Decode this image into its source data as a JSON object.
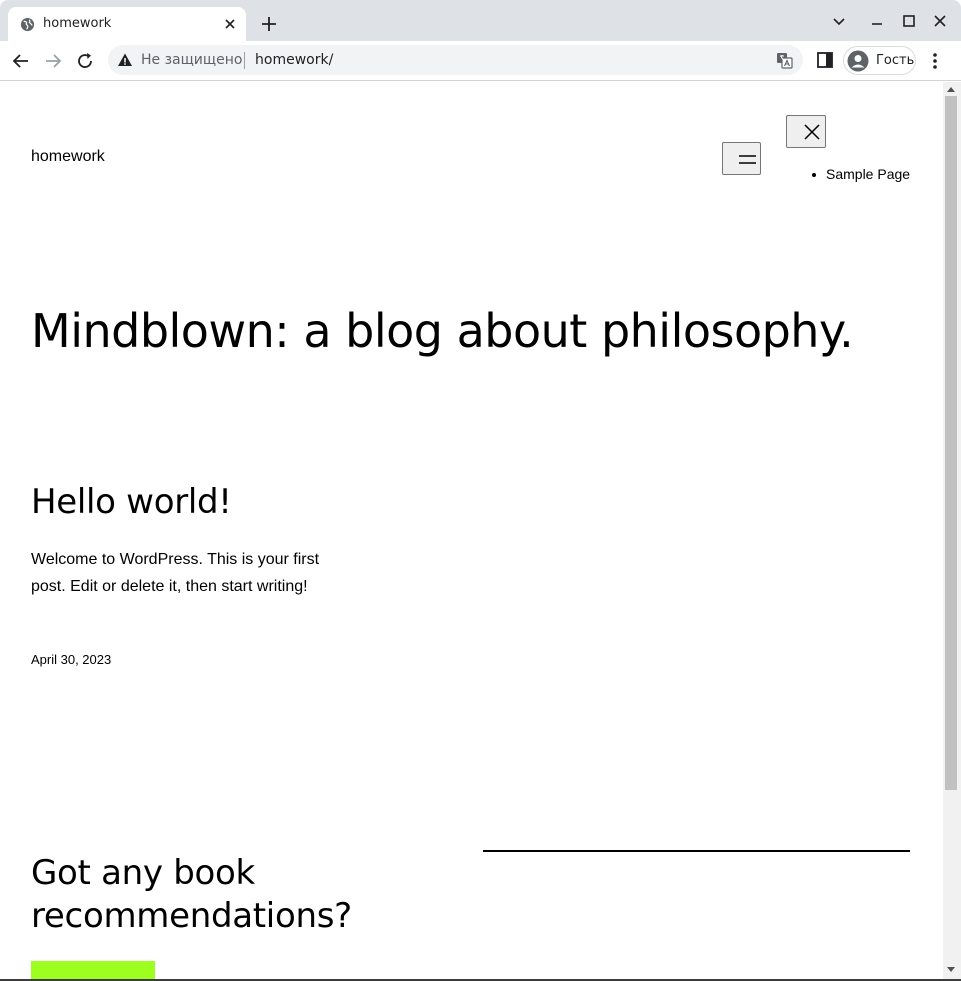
{
  "browser": {
    "tab": {
      "title": "homework"
    },
    "address_bar": {
      "security_label": "Не защищено",
      "url": "homework/"
    },
    "profile": {
      "label": "Гость"
    }
  },
  "site": {
    "title": "homework",
    "nav": {
      "items": [
        {
          "label": "Sample Page"
        }
      ]
    }
  },
  "hero": {
    "title": "Mindblown: a blog about philosophy."
  },
  "post": {
    "title": "Hello world!",
    "excerpt": "Welcome to WordPress. This is your first post. Edit or delete it, then start writing!",
    "date": "April 30, 2023"
  },
  "cta": {
    "heading": "Got any book recommendations?",
    "button_color": "#9dff20"
  },
  "colors": {
    "tabbar": "#dee1e6",
    "omnibox": "#f1f3f4",
    "accent_button": "#9dff20"
  },
  "icons": {
    "favicon": "globe-icon",
    "tab_close": "close-icon",
    "new_tab": "plus-icon",
    "back": "arrow-left-icon",
    "forward": "arrow-right-icon",
    "reload": "reload-icon",
    "security": "warning-icon",
    "translate": "translate-icon",
    "side_panel": "side-panel-icon",
    "profile": "avatar-icon",
    "menu": "kebab-menu-icon",
    "hamburger": "hamburger-icon",
    "close_menu": "close-icon"
  }
}
